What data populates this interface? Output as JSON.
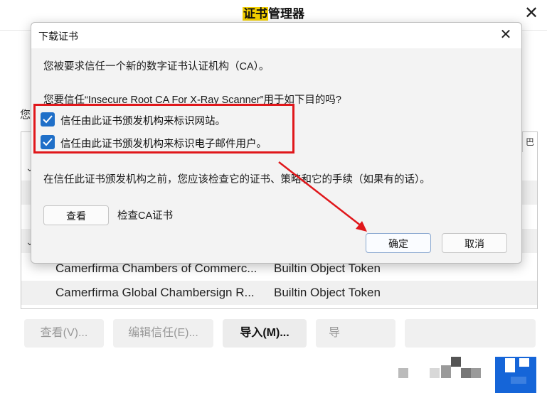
{
  "background_window": {
    "title_highlight": "证书",
    "title_rest": "管理器",
    "left_text": "您",
    "column_icon": "巴",
    "rows": [
      {
        "name": "Camerfirma Chambers of Commerc...",
        "token": "Builtin Object Token"
      },
      {
        "name": "Camerfirma Global Chambersign R...",
        "token": "Builtin Object Token"
      }
    ],
    "buttons": {
      "view": "查看(V)...",
      "edit_trust": "编辑信任(E)...",
      "import": "导入(M)...",
      "export_partial": "导"
    }
  },
  "dialog": {
    "title": "下载证书",
    "line1": "您被要求信任一个新的数字证书认证机构（CA）。",
    "question": "您要信任“Insecure Root CA For X-Ray Scanner”用于如下目的吗?",
    "checkboxes": [
      {
        "label": "信任由此证书颁发机构来标识网站。",
        "checked": true
      },
      {
        "label": "信任由此证书颁发机构来标识电子邮件用户。",
        "checked": true
      }
    ],
    "advice": "在信任此证书颁发机构之前，您应该检查它的证书、策略和它的手续（如果有的话）。",
    "view_button": "查看",
    "view_label": "检查CA证书",
    "ok_button": "确定",
    "cancel_button": "取消"
  },
  "colors": {
    "highlight": "#f4d000",
    "checkbox": "#1f6fc8",
    "annotation_red": "#e0171b"
  }
}
